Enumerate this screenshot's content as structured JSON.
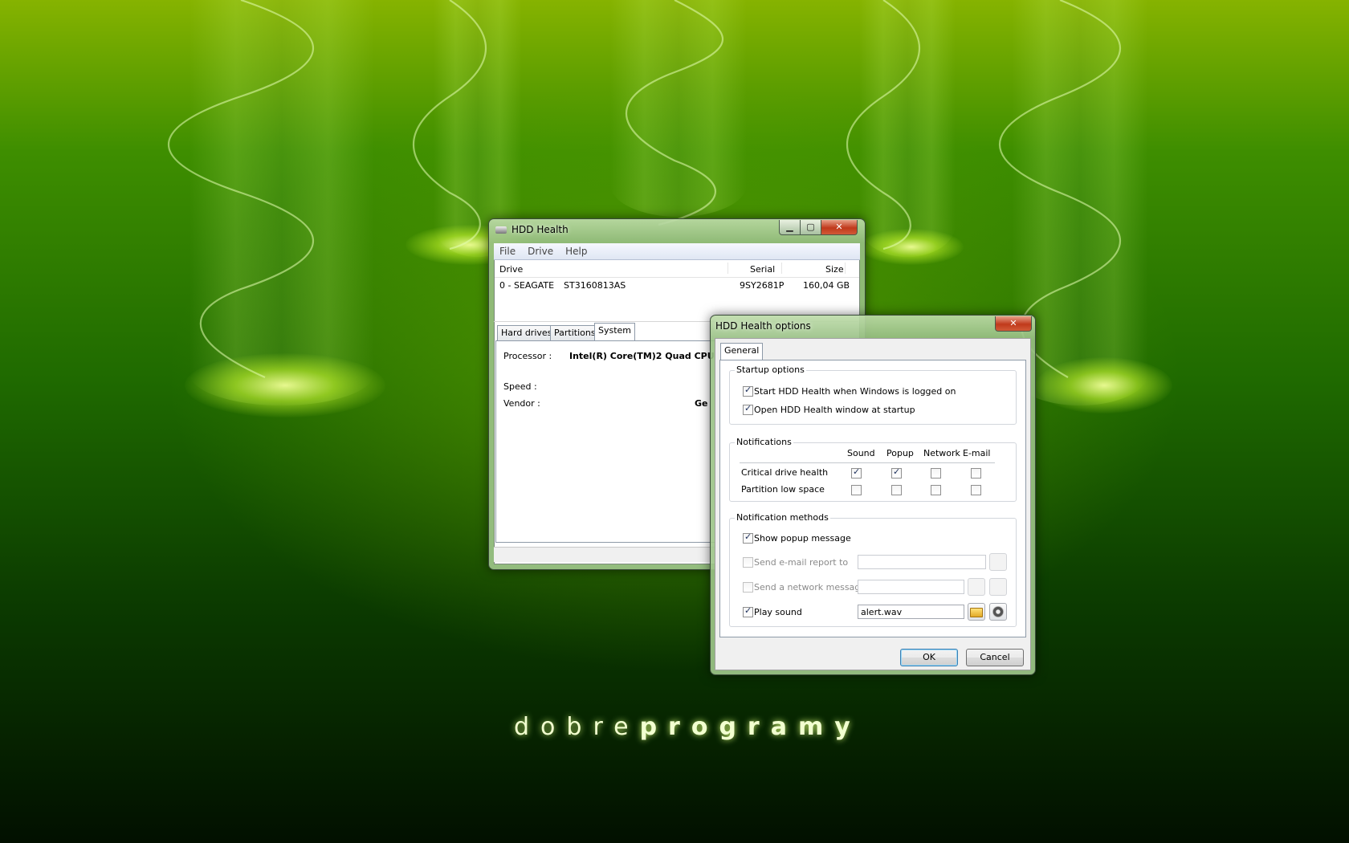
{
  "brand": {
    "part1": "dobre",
    "part2": "programy"
  },
  "main_window": {
    "title": "HDD Health",
    "controls": {
      "minimize": "▁",
      "maximize": "▢",
      "close": "✕"
    },
    "menu": [
      "File",
      "Drive",
      "Help"
    ],
    "drive_list": {
      "columns": {
        "drive": "Drive",
        "serial": "Serial",
        "size": "Size"
      },
      "rows": [
        {
          "drive": "0 - SEAGATE",
          "model": "ST3160813AS",
          "serial": "9SY2681P",
          "size": "160,04 GB"
        }
      ]
    },
    "tabs": [
      "Hard drives",
      "Partitions",
      "System"
    ],
    "active_tab": "System",
    "system": {
      "processor_label": "Processor :",
      "processor_value": "Intel(R) Core(TM)2 Quad CPU",
      "speed_label": "Speed :",
      "vendor_label": "Vendor :",
      "vendor_value": "Ge"
    }
  },
  "options_dialog": {
    "title": "HDD Health options",
    "close": "✕",
    "tab": "General",
    "startup": {
      "label": "Startup options",
      "start_when_logged_on": {
        "label": "Start HDD Health when Windows is logged on",
        "checked": true
      },
      "open_window_at_startup": {
        "label": "Open HDD Health window at startup",
        "checked": true
      }
    },
    "notifications": {
      "label": "Notifications",
      "columns": [
        "Sound",
        "Popup",
        "Network",
        "E-mail"
      ],
      "rows": [
        {
          "label": "Critical drive health",
          "sound": true,
          "popup": true,
          "network": false,
          "email": false
        },
        {
          "label": "Partition low space",
          "sound": false,
          "popup": false,
          "network": false,
          "email": false
        }
      ]
    },
    "methods": {
      "label": "Notification methods",
      "show_popup": {
        "label": "Show popup message",
        "checked": true
      },
      "send_email": {
        "label": "Send e-mail report to",
        "checked": false,
        "value": ""
      },
      "send_network": {
        "label": "Send a network message",
        "checked": false,
        "value": ""
      },
      "play_sound": {
        "label": "Play sound",
        "checked": true,
        "value": "alert.wav"
      }
    },
    "ok": "OK",
    "cancel": "Cancel"
  }
}
